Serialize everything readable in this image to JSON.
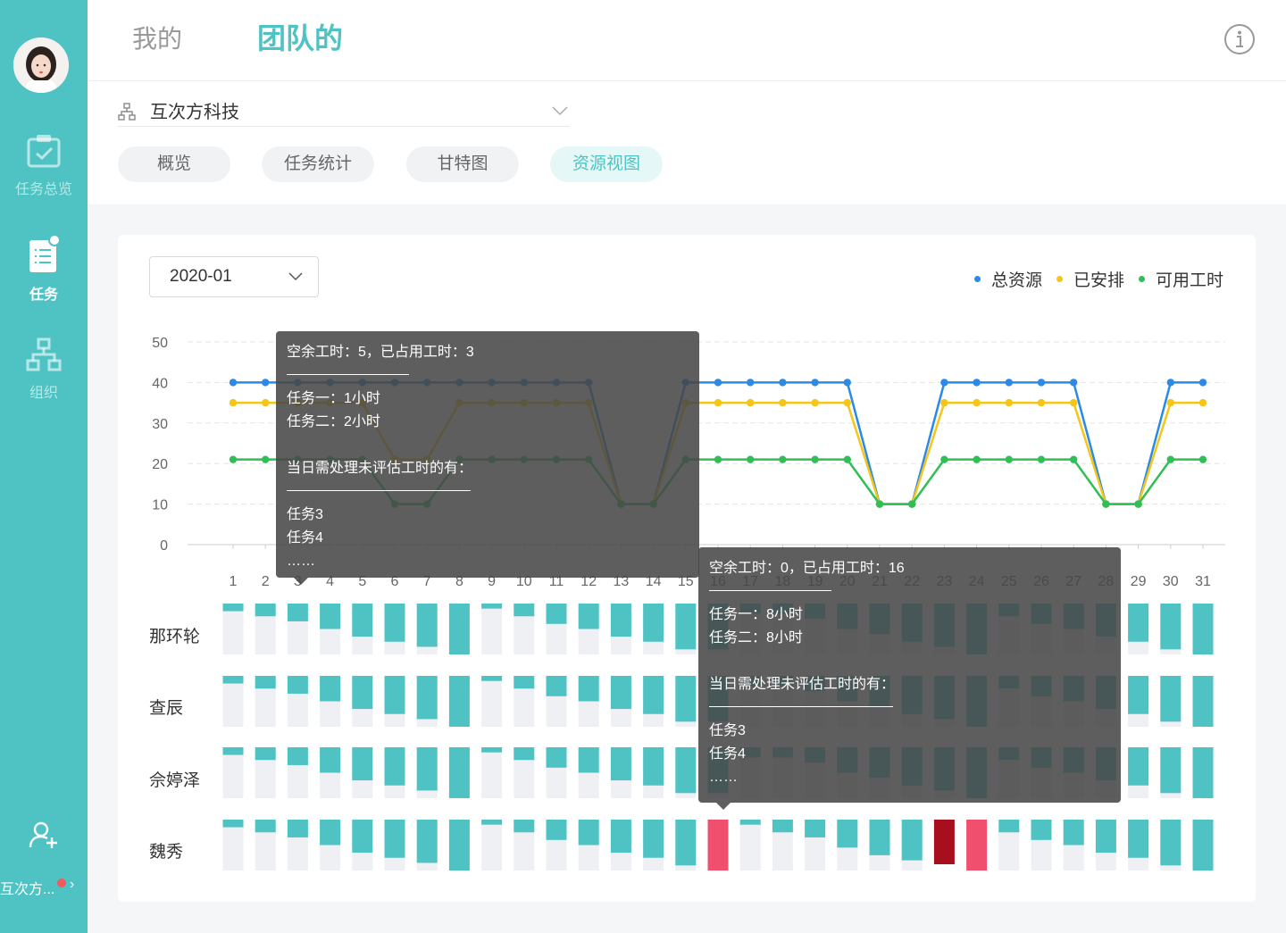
{
  "sidebar": {
    "items": [
      {
        "label": "任务总览",
        "icon": "clipboard-check-icon",
        "active": false
      },
      {
        "label": "任务",
        "icon": "task-list-icon",
        "active": true
      },
      {
        "label": "组织",
        "icon": "org-chart-icon",
        "active": false
      }
    ],
    "team_name": "互次方...",
    "add_member_icon": "add-user-icon"
  },
  "header": {
    "tabs": [
      {
        "label": "我的",
        "active": false
      },
      {
        "label": "团队的",
        "active": true
      }
    ],
    "info_icon": "info-icon"
  },
  "filter": {
    "org_name": "互次方科技",
    "view_tabs": [
      {
        "label": "概览",
        "active": false
      },
      {
        "label": "任务统计",
        "active": false
      },
      {
        "label": "甘特图",
        "active": false
      },
      {
        "label": "资源视图",
        "active": true
      }
    ]
  },
  "panel": {
    "month": "2020-01",
    "legend": [
      {
        "label": "总资源",
        "color": "#2b8ae8"
      },
      {
        "label": "已安排",
        "color": "#f5c518"
      },
      {
        "label": "可用工时",
        "color": "#2fbf54"
      }
    ]
  },
  "people": [
    "那环轮",
    "查辰",
    "佘婷泽",
    "魏秀"
  ],
  "chart_data": {
    "type": "line",
    "x": [
      1,
      2,
      3,
      4,
      5,
      6,
      7,
      8,
      9,
      10,
      11,
      12,
      13,
      14,
      15,
      16,
      17,
      18,
      19,
      20,
      21,
      22,
      23,
      24,
      25,
      26,
      27,
      28,
      29,
      30,
      31
    ],
    "ylim": [
      0,
      50
    ],
    "yticks": [
      0,
      10,
      20,
      30,
      40,
      50
    ],
    "grid": true,
    "legend_position": "top-right",
    "series": [
      {
        "name": "总资源",
        "color": "#2b8ae8",
        "values": [
          40,
          40,
          40,
          40,
          40,
          40,
          40,
          40,
          40,
          40,
          40,
          40,
          10,
          10,
          40,
          40,
          40,
          40,
          40,
          40,
          10,
          10,
          40,
          40,
          40,
          40,
          40,
          10,
          10,
          40,
          40
        ]
      },
      {
        "name": "已安排",
        "color": "#f5c518",
        "values": [
          35,
          35,
          35,
          35,
          35,
          21,
          21,
          35,
          35,
          35,
          35,
          35,
          10,
          10,
          35,
          35,
          35,
          35,
          35,
          35,
          10,
          10,
          35,
          35,
          35,
          35,
          35,
          10,
          10,
          35,
          35
        ]
      },
      {
        "name": "可用工时",
        "color": "#2fbf54",
        "values": [
          21,
          21,
          21,
          21,
          21,
          10,
          10,
          21,
          21,
          21,
          21,
          21,
          10,
          10,
          21,
          21,
          21,
          21,
          21,
          21,
          10,
          10,
          21,
          21,
          21,
          21,
          21,
          10,
          10,
          21,
          21
        ]
      }
    ],
    "heatmap": {
      "rows": [
        "那环轮",
        "查辰",
        "佘婷泽",
        "魏秀"
      ],
      "fill_fraction": [
        [
          0.15,
          0.25,
          0.35,
          0.5,
          0.65,
          0.75,
          0.85,
          1.0,
          0.1,
          0.25,
          0.4,
          0.5,
          0.65,
          0.75,
          0.9,
          0.9,
          0.2,
          0.2,
          0.3,
          0.5,
          0.6,
          0.75,
          0.85,
          1.0,
          0.25,
          0.4,
          0.5,
          0.65,
          0.75,
          0.9,
          1.0
        ],
        [
          0.15,
          0.25,
          0.35,
          0.5,
          0.65,
          0.75,
          0.85,
          1.0,
          0.1,
          0.25,
          0.4,
          0.5,
          0.65,
          0.75,
          0.9,
          0.9,
          0.2,
          0.2,
          0.3,
          0.5,
          0.6,
          0.75,
          0.85,
          1.0,
          0.25,
          0.4,
          0.5,
          0.65,
          0.75,
          0.9,
          1.0
        ],
        [
          0.15,
          0.25,
          0.35,
          0.5,
          0.65,
          0.75,
          0.85,
          1.0,
          0.1,
          0.25,
          0.4,
          0.5,
          0.65,
          0.75,
          0.9,
          0.9,
          0.2,
          0.2,
          0.3,
          0.5,
          0.6,
          0.75,
          0.85,
          1.0,
          0.25,
          0.4,
          0.5,
          0.65,
          0.75,
          0.9,
          1.0
        ],
        [
          0.15,
          0.25,
          0.35,
          0.5,
          0.65,
          0.75,
          0.85,
          1.0,
          0.1,
          0.25,
          0.4,
          0.5,
          0.65,
          0.75,
          0.9,
          1.0,
          0.1,
          0.25,
          0.35,
          0.55,
          0.7,
          0.8,
          0.9,
          1.0,
          0.25,
          0.4,
          0.5,
          0.65,
          0.75,
          0.9,
          1.0
        ]
      ],
      "overload_cells": [
        {
          "row": 3,
          "day": 16,
          "color": "#f0506e"
        },
        {
          "row": 3,
          "day": 24,
          "color": "#f0506e"
        },
        {
          "row": 3,
          "day": 23,
          "color": "#a80f1e"
        }
      ],
      "fill_color": "#4fc3c3",
      "empty_color": "#eef0f4"
    }
  },
  "tooltips": [
    {
      "summary": "空余工时：5，已占用工时：3",
      "tasks": [
        "任务一：1小时",
        "任务二：2小时"
      ],
      "unestimated_title": "当日需处理未评估工时的有：",
      "unestimated": [
        "任务3",
        "任务4",
        "……"
      ]
    },
    {
      "summary": "空余工时：0，已占用工时：16",
      "tasks": [
        "任务一：8小时",
        "任务二：8小时"
      ],
      "unestimated_title": "当日需处理未评估工时的有：",
      "unestimated": [
        "任务3",
        "任务4",
        "……"
      ]
    }
  ]
}
